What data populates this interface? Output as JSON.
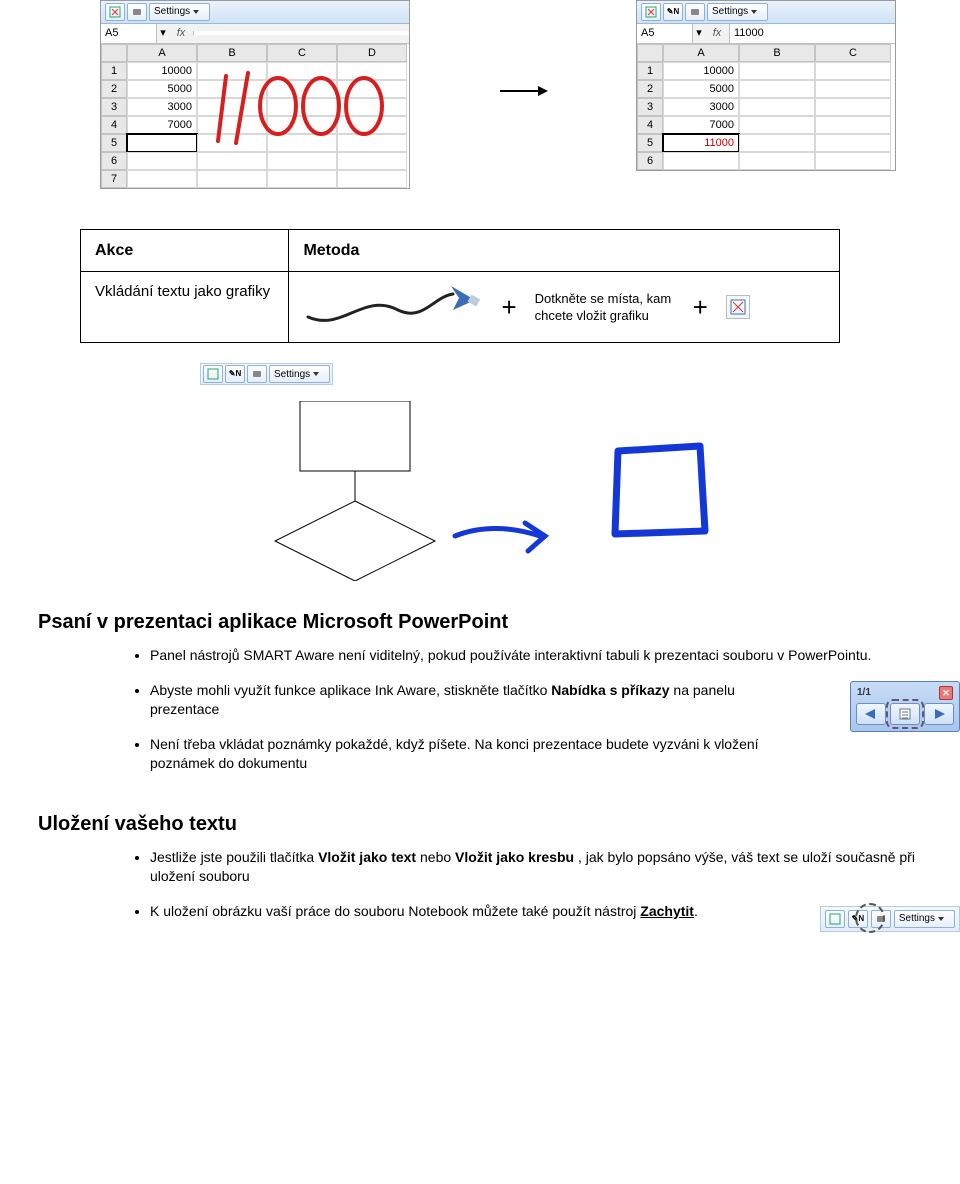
{
  "spreadsheets": {
    "settings_label": "Settings",
    "fx_label": "fx",
    "left": {
      "cellref": "A5",
      "fxvalue": "",
      "cols": [
        "A",
        "B",
        "C",
        "D"
      ],
      "rows": [
        "1",
        "2",
        "3",
        "4",
        "5",
        "6",
        "7"
      ],
      "a_values": [
        "10000",
        "5000",
        "3000",
        "7000",
        "",
        "",
        ""
      ],
      "selected_row": "5",
      "handwritten_value": "11000"
    },
    "right": {
      "cellref": "A5",
      "fxvalue": "11000",
      "cols": [
        "A",
        "B",
        "C"
      ],
      "rows": [
        "1",
        "2",
        "3",
        "4",
        "5",
        "6"
      ],
      "a_values": [
        "10000",
        "5000",
        "3000",
        "7000",
        "11000",
        ""
      ],
      "selected_row": "5",
      "red_value_row": "5"
    }
  },
  "table": {
    "h1": "Akce",
    "h2": "Metoda",
    "row_action": "Vkládání textu jako grafiky",
    "row_method": "Dotkněte se místa, kam chcete vložit grafiku"
  },
  "section1": {
    "title": "Psaní v prezentaci aplikace Microsoft PowerPoint",
    "b1": "Panel nástrojů SMART Aware není viditelný, pokud používáte interaktivní tabuli k prezentaci souboru v PowerPointu.",
    "b2_pre": "Abyste mohli využít funkce aplikace Ink Aware, stiskněte tlačítko ",
    "b2_bold": "Nabídka s příkazy",
    "b2_post": " na panelu prezentace",
    "b3": "Není třeba vkládat poznámky pokaždé, když píšete. Na konci prezentace budete vyzváni k vložení poznámek do dokumentu",
    "widget_counter": "1/1"
  },
  "section2": {
    "title": "Uložení vašeho textu",
    "b1_pre": "Jestliže jste použili tlačítka ",
    "b1_bold1": "Vložit jako text",
    "b1_mid": " nebo ",
    "b1_bold2": "Vložit jako kresbu",
    "b1_post": " , jak bylo popsáno výše, váš text se uloží současně při uložení souboru",
    "b2_pre": "K uložení obrázku vaší práce do souboru Notebook můžete také použít nástroj ",
    "b2_bold": "Zachytit",
    "b2_post": ".",
    "settings_label": "Settings"
  }
}
